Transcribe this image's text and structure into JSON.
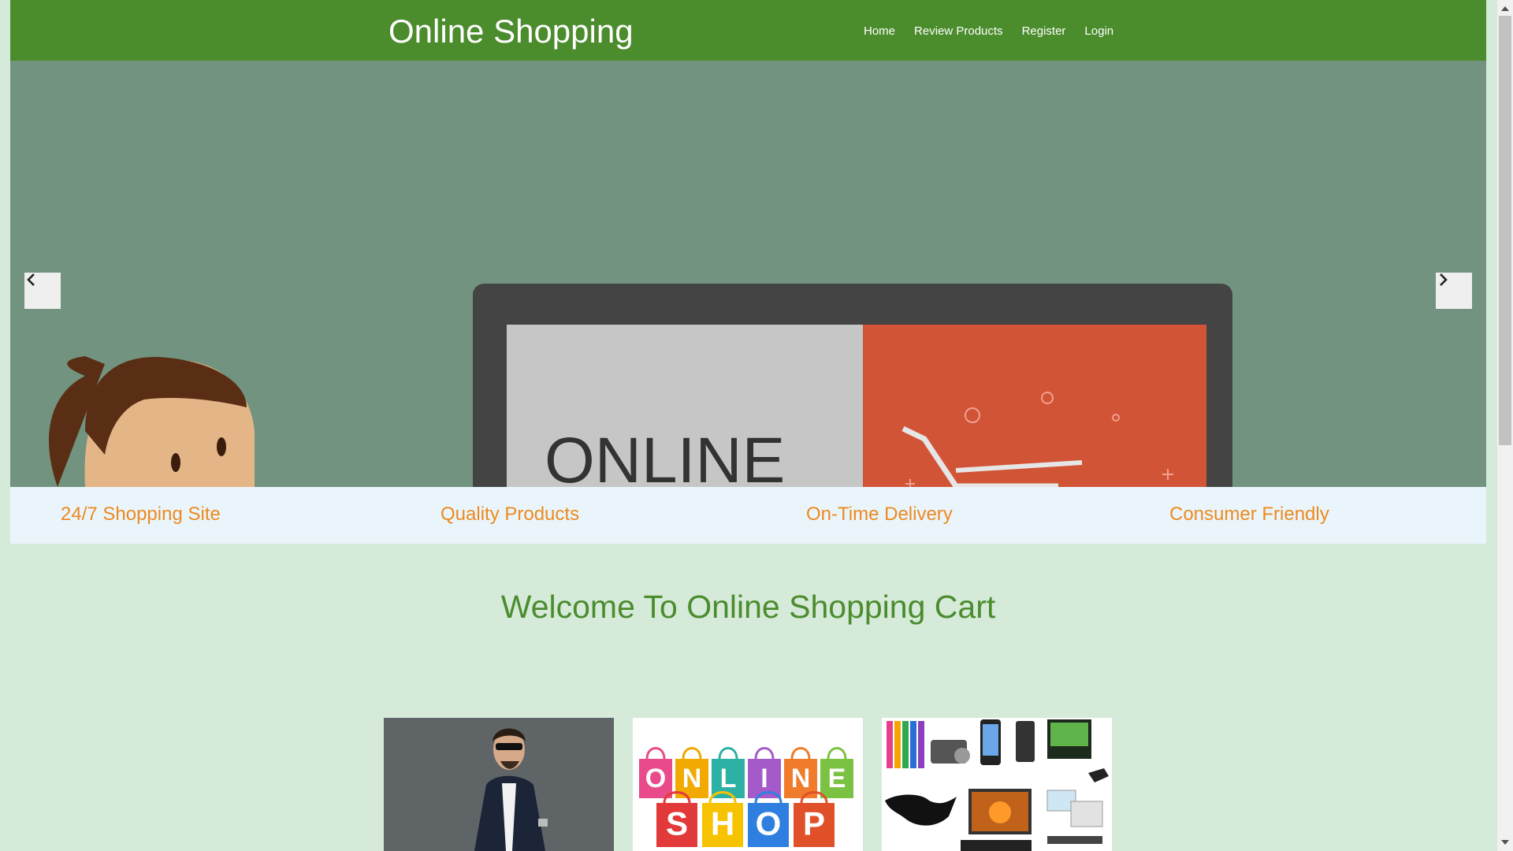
{
  "header": {
    "brand": "Online Shopping",
    "nav": [
      "Home",
      "Review Products",
      "Register",
      "Login"
    ]
  },
  "hero": {
    "screen_text": "ONLINE",
    "prev_icon": "chevron-left-icon",
    "next_icon": "chevron-right-icon"
  },
  "features": [
    "24/7 Shopping Site",
    "Quality Products",
    "On-Time Delivery",
    "Consumer Friendly"
  ],
  "welcome": "Welcome To Online Shopping Cart",
  "thumbnails": {
    "shop_bags": [
      "O",
      "N",
      "L",
      "I",
      "N",
      "E",
      "S",
      "H",
      "O",
      "P"
    ]
  },
  "colors": {
    "header_bg": "#4b8c2d",
    "hero_bg": "#71937f",
    "feature_text": "#ec8a1f",
    "welcome_text": "#4b8c2d",
    "page_bg": "#d5ead8"
  }
}
